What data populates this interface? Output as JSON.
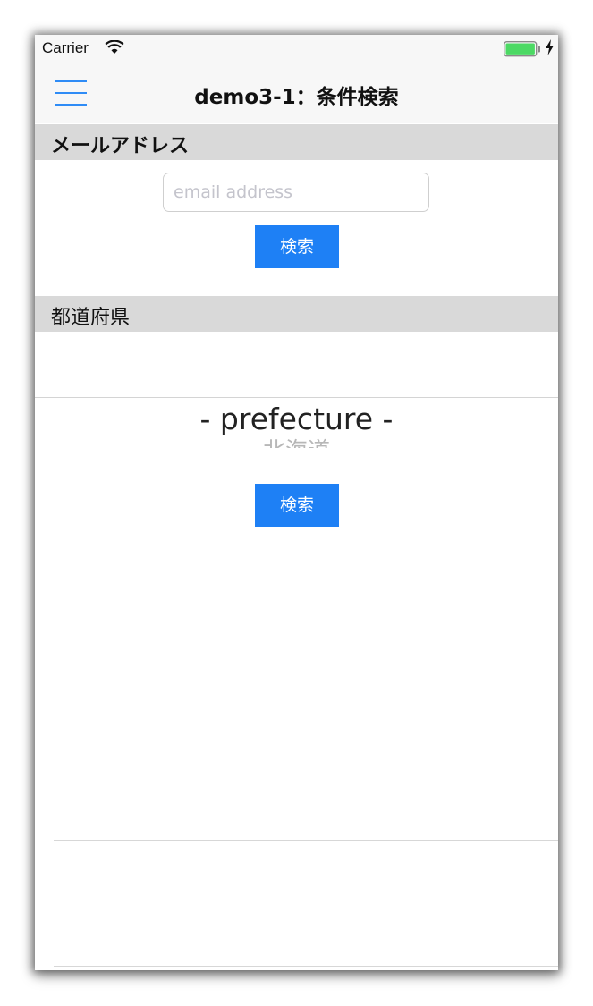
{
  "status_bar": {
    "carrier": "Carrier",
    "icons": [
      "wifi-icon",
      "battery-icon",
      "charging-bolt-icon"
    ],
    "battery_color": "#4cd964"
  },
  "nav": {
    "menu_icon": "hamburger-menu-icon",
    "title": "demo3-1：条件検索",
    "accent_color": "#2f8cf6"
  },
  "email_section": {
    "header": "メールアドレス",
    "input_placeholder": "email address",
    "search_button": "検索"
  },
  "prefecture_section": {
    "header": "都道府県",
    "picker_selected": "- prefecture -",
    "picker_next": "北海道",
    "search_button": "検索"
  },
  "colors": {
    "button_background": "#1e80f5",
    "section_header_background": "#d9d9d9"
  }
}
